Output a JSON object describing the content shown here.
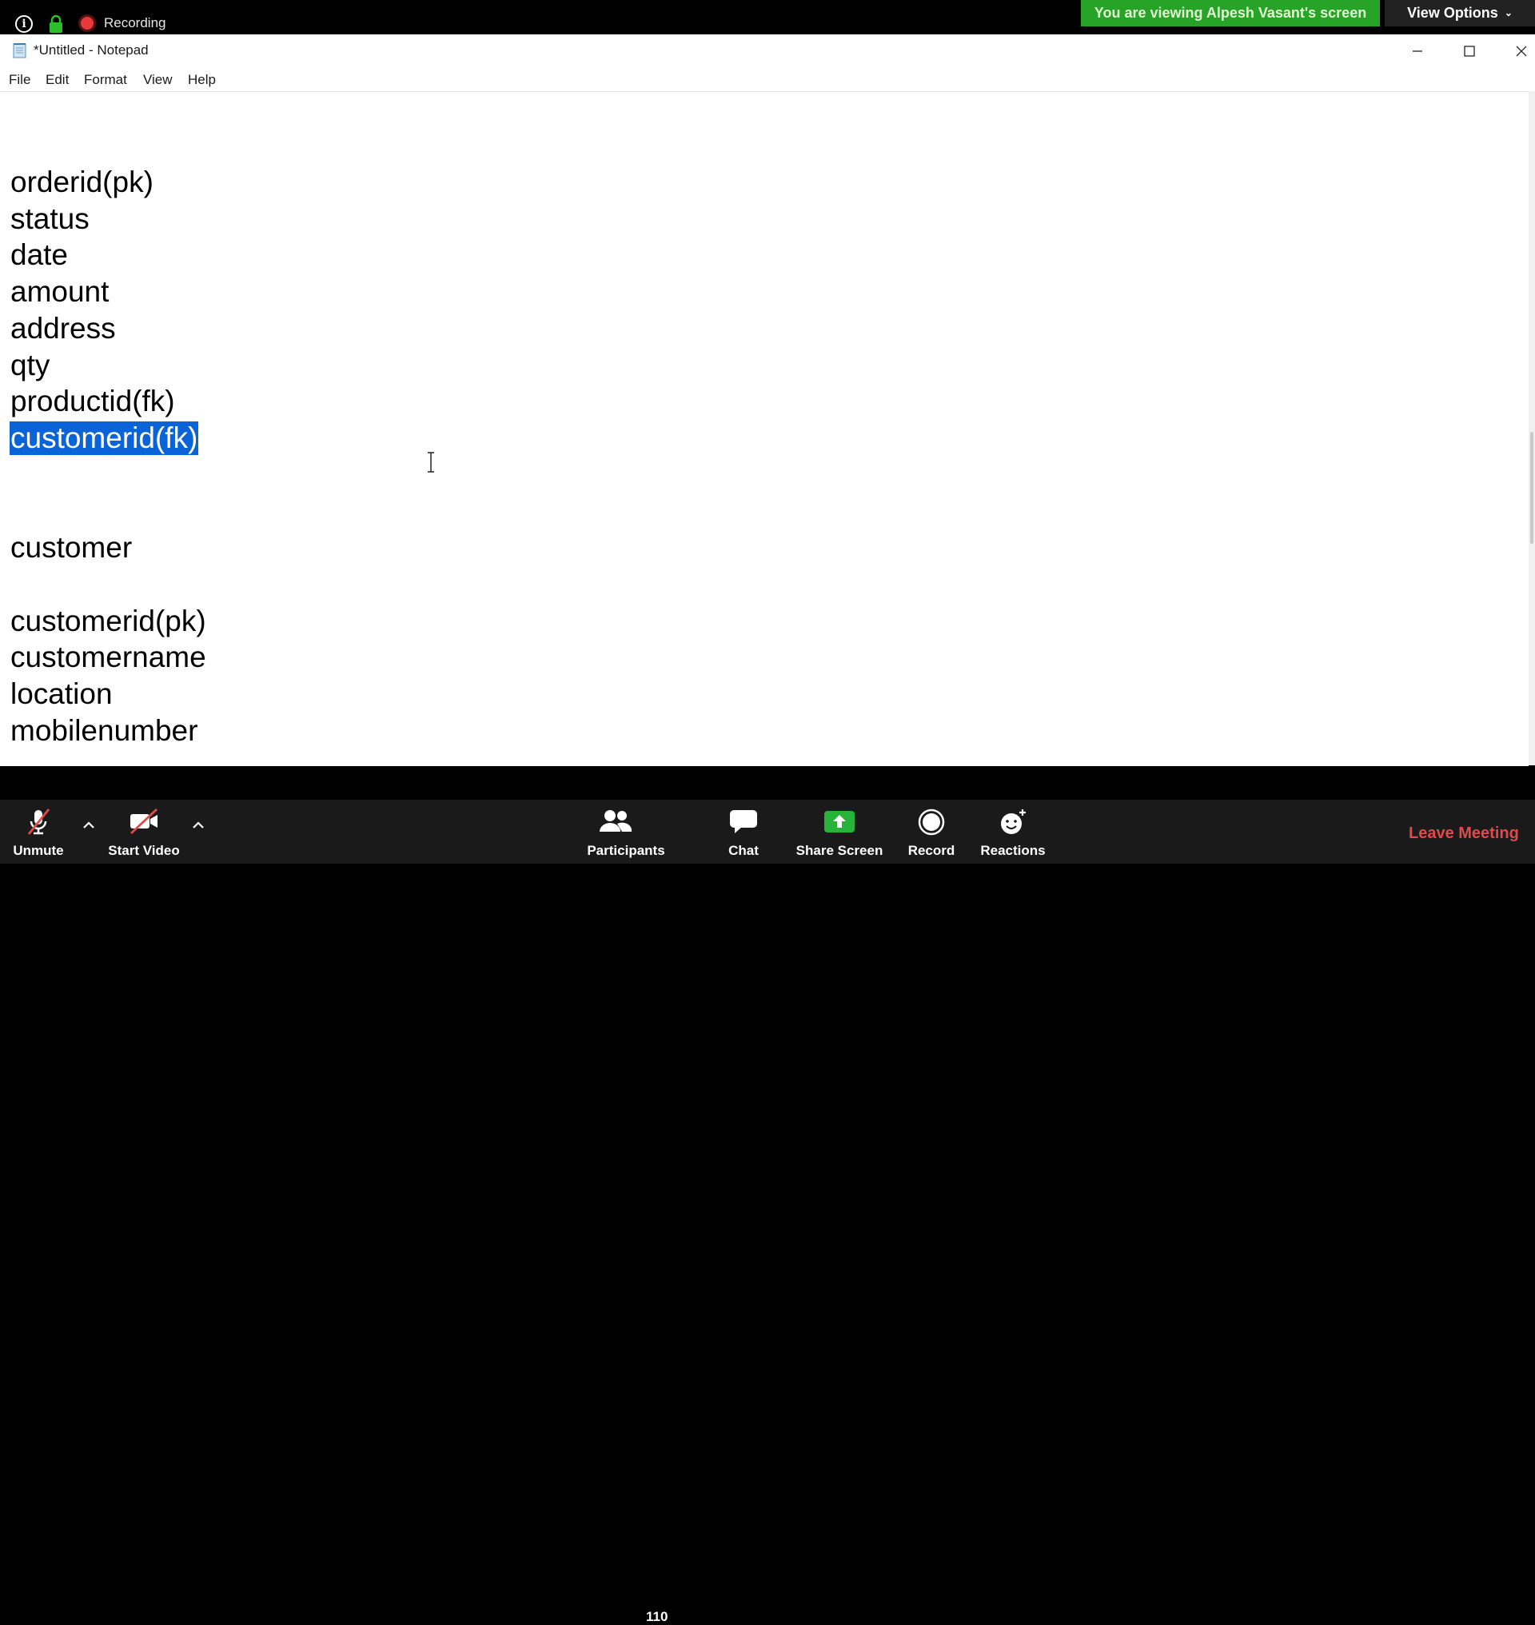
{
  "zoom_top": {
    "recording_label": "Recording",
    "viewing_banner": "You are viewing Alpesh Vasant's screen",
    "view_options_label": "View Options",
    "banner_color": "#27a327",
    "recording_color": "#e8393a"
  },
  "notepad": {
    "title": "*Untitled - Notepad",
    "menu": [
      "File",
      "Edit",
      "Format",
      "View",
      "Help"
    ],
    "lines": [
      "orderid(pk)",
      "status",
      "date",
      "amount",
      "address",
      "qty",
      "productid(fk)",
      "customerid(fk)",
      "customer",
      "customerid(pk)",
      "customername",
      "location",
      "mobilenumber"
    ],
    "selected_line_index": 7,
    "selection_color": "#0a64d8"
  },
  "zoom_bottom": {
    "unmute_label": "Unmute",
    "start_video_label": "Start Video",
    "participants_label": "Participants",
    "participants_count": "110",
    "chat_label": "Chat",
    "share_screen_label": "Share Screen",
    "record_label": "Record",
    "reactions_label": "Reactions",
    "leave_label": "Leave Meeting",
    "share_color": "#27b33a",
    "leave_color": "#e04a4a"
  }
}
